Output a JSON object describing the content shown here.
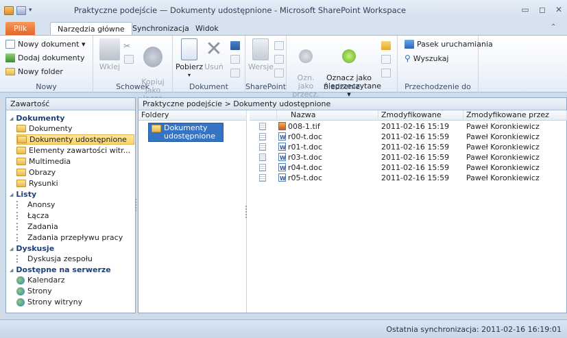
{
  "window": {
    "title": "Praktyczne podejście — Dokumenty udostępnione - Microsoft SharePoint Workspace",
    "minimize": "▭",
    "maximize": "◻",
    "close": "✕"
  },
  "tabs": [
    "Plik",
    "Narzędzia główne",
    "Synchronizacja",
    "Widok"
  ],
  "ribbon": {
    "nowy": {
      "new_doc": "Nowy dokument ▾",
      "add_docs": "Dodaj dokumenty",
      "new_folder": "Nowy folder",
      "label": "Nowy"
    },
    "schowek": {
      "paste": "Wklej",
      "copy_link": "Kopiuj\njako łącze",
      "label": "Schowek"
    },
    "dokument": {
      "download": "Pobierz",
      "delete": "Usuń",
      "label": "Dokument"
    },
    "sharepoint": {
      "versions": "Wersje",
      "label": "SharePoint"
    },
    "sledzenie": {
      "mark_read": "Ozn. jako\nprzecz. ▾",
      "mark_unread": "Oznacz jako\nnieprzeczytane ▾",
      "label": "Śledzenie"
    },
    "przechodzenie": {
      "launchbar": "Pasek uruchamiania",
      "search": "Wyszukaj",
      "label": "Przechodzenie do"
    }
  },
  "navpane": {
    "header": "Zawartość",
    "sections": [
      {
        "title": "Dokumenty",
        "items": [
          "Dokumenty",
          "Dokumenty udostępnione",
          "Elementy zawartości witr...",
          "Multimedia",
          "Obrazy",
          "Rysunki"
        ]
      },
      {
        "title": "Listy",
        "items": [
          "Anonsy",
          "Łącza",
          "Zadania",
          "Zadania przepływu pracy"
        ]
      },
      {
        "title": "Dyskusje",
        "items": [
          "Dyskusja zespołu"
        ]
      },
      {
        "title": "Dostępne na serwerze",
        "items": [
          "Kalendarz",
          "Strony",
          "Strony witryny"
        ]
      }
    ],
    "selected": "Dokumenty udostępnione"
  },
  "breadcrumb": "Praktyczne podejście > Dokumenty udostępnione",
  "folders": {
    "header": "Foldery",
    "items": [
      "Dokumenty\nudostępnione"
    ]
  },
  "files": {
    "columns": [
      "Nazwa",
      "Zmodyfikowane",
      "Zmodyfikowane przez"
    ],
    "rows": [
      {
        "name": "008-1.tif",
        "modified": "2011-02-16 15:19",
        "by": "Paweł Koronkiewicz",
        "type": "image"
      },
      {
        "name": "r00-t.doc",
        "modified": "2011-02-16 15:59",
        "by": "Paweł Koronkiewicz",
        "type": "doc"
      },
      {
        "name": "r01-t.doc",
        "modified": "2011-02-16 15:59",
        "by": "Paweł Koronkiewicz",
        "type": "doc"
      },
      {
        "name": "r03-t.doc",
        "modified": "2011-02-16 15:59",
        "by": "Paweł Koronkiewicz",
        "type": "doc"
      },
      {
        "name": "r04-t.doc",
        "modified": "2011-02-16 15:59",
        "by": "Paweł Koronkiewicz",
        "type": "doc"
      },
      {
        "name": "r05-t.doc",
        "modified": "2011-02-16 15:59",
        "by": "Paweł Koronkiewicz",
        "type": "doc"
      }
    ]
  },
  "status": "Ostatnia synchronizacja: 2011-02-16 16:19:01"
}
